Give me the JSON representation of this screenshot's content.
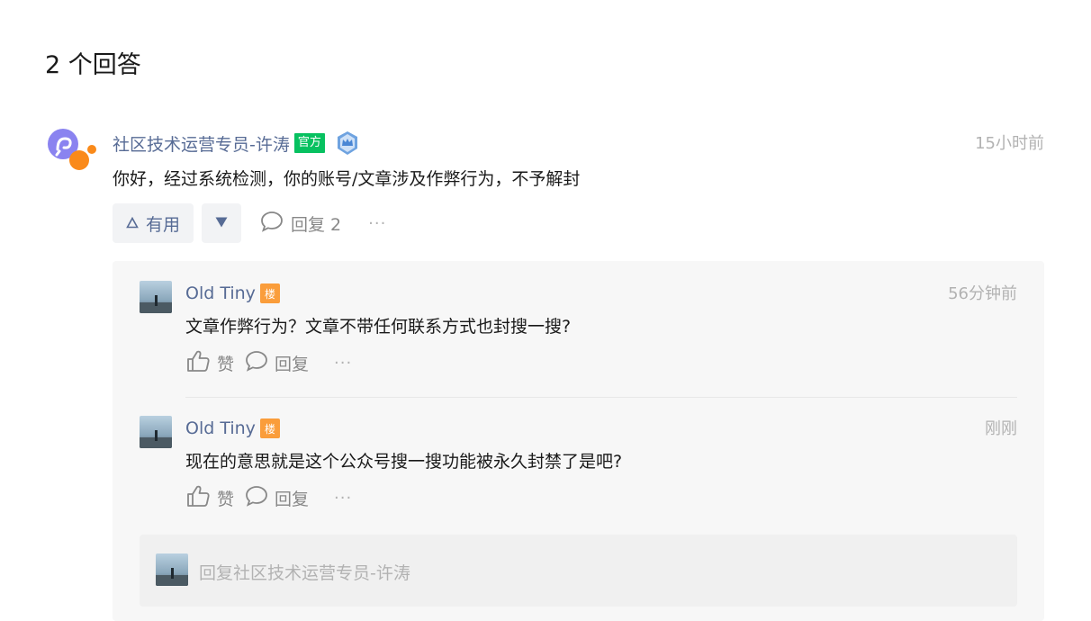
{
  "header": {
    "answers_count_title": "2 个回答"
  },
  "answer": {
    "author": "社区技术运营专员-许涛",
    "official_badge": "官方",
    "time": "15小时前",
    "content": "你好，经过系统检测，你的账号/文章涉及作弊行为，不予解封",
    "actions": {
      "useful_label": "有用",
      "reply_label": "回复 2",
      "more_label": "···"
    },
    "level_icon": "crown-shield-icon"
  },
  "replies": [
    {
      "author": "Old Tiny",
      "floor_badge": "楼",
      "time": "56分钟前",
      "content": "文章作弊行为？文章不带任何联系方式也封搜一搜?",
      "like_label": "赞",
      "reply_label": "回复",
      "more_label": "···"
    },
    {
      "author": "Old Tiny",
      "floor_badge": "楼",
      "time": "刚刚",
      "content": "现在的意思就是这个公众号搜一搜功能被永久封禁了是吧?",
      "like_label": "赞",
      "reply_label": "回复",
      "more_label": "···"
    }
  ],
  "reply_box": {
    "placeholder": "回复社区技术运营专员-许涛"
  },
  "colors": {
    "link": "#576b95",
    "official": "#07c160",
    "floor": "#fa9d3b",
    "muted": "#b2b2b2"
  }
}
